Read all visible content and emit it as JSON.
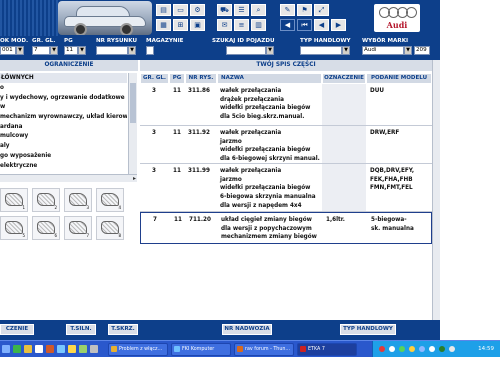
{
  "brand": {
    "name": "Audi",
    "ring_color": "#666666",
    "text_color": "#b4142a"
  },
  "header": {
    "toolbar_row1": [
      {
        "icon": "print-icon",
        "glyph": "▤"
      },
      {
        "icon": "window-icon",
        "glyph": "▭"
      },
      {
        "icon": "tool-icon",
        "glyph": "⚙"
      },
      {
        "icon": "car-icon",
        "glyph": "⛟"
      },
      {
        "icon": "list-icon",
        "glyph": "☰"
      },
      {
        "icon": "zoom-icon",
        "glyph": "⌕"
      },
      {
        "icon": "edit-icon",
        "glyph": "✎"
      },
      {
        "icon": "flag-icon",
        "glyph": "⚑"
      },
      {
        "icon": "pin-icon",
        "glyph": "⤢"
      }
    ],
    "toolbar_row2": [
      {
        "icon": "parts-icon",
        "glyph": "▦"
      },
      {
        "icon": "cart-icon",
        "glyph": "⊞"
      },
      {
        "icon": "page-icon",
        "glyph": "▣"
      },
      {
        "icon": "note-icon",
        "glyph": "✉"
      },
      {
        "icon": "id-icon",
        "glyph": "≡"
      },
      {
        "icon": "doc-icon",
        "glyph": "▥"
      },
      {
        "icon": "back-icon",
        "glyph": "◀"
      },
      {
        "icon": "first-icon",
        "glyph": "⏮"
      },
      {
        "icon": "prev-icon",
        "glyph": "◀"
      },
      {
        "icon": "next-icon",
        "glyph": "▶"
      }
    ]
  },
  "filters": {
    "katalog": {
      "label": "OK MOD.",
      "value": "001"
    },
    "gr_gl": {
      "label": "GR. GL.",
      "value": "7"
    },
    "pg": {
      "label": "PG",
      "value": "11"
    },
    "nr_rysunku": {
      "label": "NR RYSUNKU",
      "value": ""
    },
    "magazynie": {
      "label": "MAGAZYNIE",
      "value": ""
    },
    "szukaj_id": {
      "label": "SZUKAJ ID POJAZDU",
      "value": ""
    },
    "typ_handlowy": {
      "label": "TYP HANDLOWY",
      "value": ""
    },
    "wybor_marki": {
      "label": "WYBÓR MARKI",
      "value": "Audi"
    },
    "code": "209"
  },
  "sections": {
    "left": "OGRANICZENIE",
    "right": "TWÓJ SPIS CZĘŚCI"
  },
  "categories": {
    "header": "ŁÓWNYCH",
    "items": [
      "o",
      "y i wydechowy, ogrzewanie dodatkowe",
      "w",
      "mechanizm wyrownawczy, układ kierowni",
      "ardana",
      "mulcowy",
      "aly",
      "go wyposażenie",
      "elektryczne"
    ]
  },
  "thumbnails": [
    "1",
    "2",
    "3",
    "4",
    "5",
    "6",
    "7",
    "8"
  ],
  "table": {
    "columns": [
      "GR. GL.",
      "PG",
      "NR RYS.",
      "NAZWA",
      "OZNACZENIE",
      "PODANIE MODELU"
    ],
    "rows": [
      {
        "gr": "3",
        "pg": "11",
        "nr": "311.86",
        "nazwa": [
          "wałek przełączania",
          "drążek przełączania",
          "widełki przełączania biegów",
          "dla 5cio bieg.skrz.manual."
        ],
        "oznaczenie": "",
        "model": [
          "DUU"
        ]
      },
      {
        "gr": "3",
        "pg": "11",
        "nr": "311.92",
        "nazwa": [
          "wałek przełączania",
          "jarzmo",
          "widełki przełączania biegów",
          "dla 6-biegowej skrzyni manual."
        ],
        "oznaczenie": "",
        "model": [
          "DRW,ERF"
        ]
      },
      {
        "gr": "3",
        "pg": "11",
        "nr": "311.99",
        "nazwa": [
          "wałek przełączania",
          "jarzmo",
          "widełki przełączania biegów",
          "6-biegowa skrzynia manualna",
          "dla wersji z napędem 4x4"
        ],
        "oznaczenie": "",
        "model": [
          "DQB,DRV,EFY,",
          "FEK,FHA,FHB",
          "FMN,FMT,FEL"
        ]
      },
      {
        "gr": "7",
        "pg": "11",
        "nr": "711.20",
        "nazwa": [
          "układ cięgieł zmiany biegów",
          "dla wersji z popychaczowym",
          "mechanizmem zmiany biegów"
        ],
        "oznaczenie": "1,6ltr.",
        "model": [
          "5-biegowa-",
          "sk. manualna"
        ]
      }
    ]
  },
  "function_bar": [
    "CZENIE",
    "T.SILN.",
    "T.SKRZ.",
    "NR NADWOZIA",
    "TYP HANDLOWY"
  ],
  "taskbar": {
    "tasks": [
      {
        "label": "Problem z włącz...",
        "color": "#e8b030"
      },
      {
        "label": "FKI Komputer",
        "color": "#6fc0ff"
      },
      {
        "label": "rav forum - Thun...",
        "color": "#d86a1e"
      },
      {
        "label": "ETKA 7",
        "color": "#cc2222"
      }
    ],
    "clock": "14:59"
  }
}
